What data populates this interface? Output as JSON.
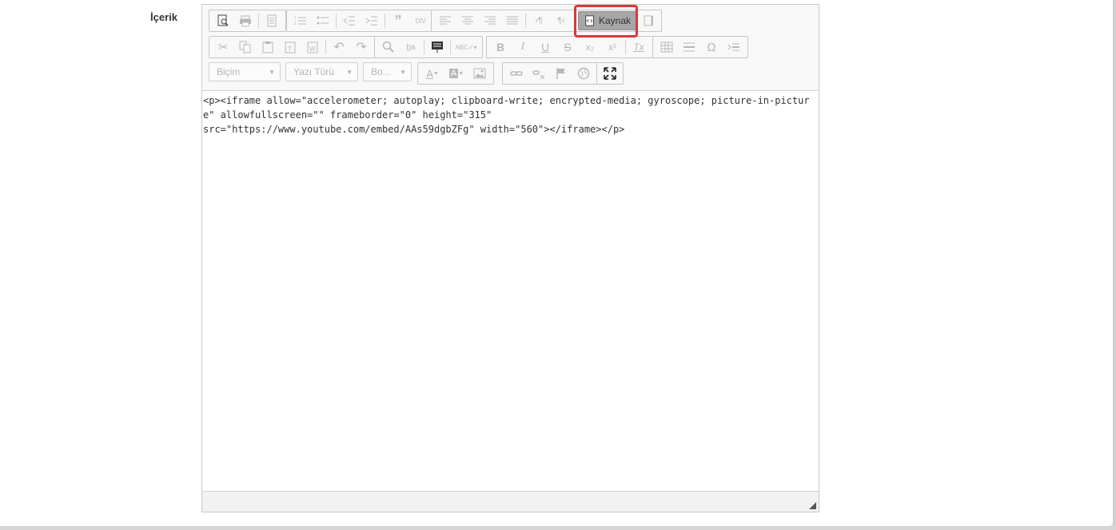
{
  "field_label": "İçerik",
  "toolbar": {
    "row1": {
      "document": [
        "preview-icon",
        "print-icon",
        "templates-icon"
      ],
      "lists": [
        "numbered-list-icon",
        "bulleted-list-icon",
        "decrease-indent-icon",
        "increase-indent-icon",
        "blockquote-icon",
        "create-div-icon"
      ],
      "align": [
        "align-left-icon",
        "align-center-icon",
        "align-right-icon",
        "justify-icon",
        "ltr-icon",
        "rtl-icon"
      ],
      "source_label": "Kaynak",
      "showblocks": "show-blocks-icon"
    },
    "row2": {
      "clipboard": [
        "cut-icon",
        "copy-icon",
        "paste-icon",
        "paste-text-icon",
        "paste-word-icon",
        "undo-icon",
        "redo-icon"
      ],
      "find": [
        "find-icon",
        "replace-icon",
        "select-all-icon",
        "spellcheck-icon"
      ],
      "basic": {
        "bold": "B",
        "italic": "I",
        "underline": "U",
        "strike": "S",
        "subscript": "x₂",
        "superscript": "x²",
        "removeformat": "Tx"
      },
      "insert": {
        "table": "table-icon",
        "hr": "horizontal-rule-icon",
        "specialchar": "Ω",
        "pagebreak": "page-break-icon"
      }
    },
    "row3": {
      "format_placeholder": "Biçim",
      "font_placeholder": "Yazı Türü",
      "size_placeholder": "Bo...",
      "text_color": "A",
      "bg_color": "A",
      "links": [
        "image-icon",
        "link-icon",
        "unlink-icon",
        "anchor-icon",
        "iframe-icon"
      ],
      "maximize": "maximize-icon"
    }
  },
  "source_text": "<p><iframe allow=\"accelerometer; autoplay; clipboard-write; encrypted-media; gyroscope; picture-in-picture\" allowfullscreen=\"\" frameborder=\"0\" height=\"315\"\nsrc=\"https://www.youtube.com/embed/AAs59dgbZFg\" width=\"560\"></iframe></p>",
  "colors": {
    "highlight": "#d63a3a",
    "active_button": "#a7a7a7"
  }
}
